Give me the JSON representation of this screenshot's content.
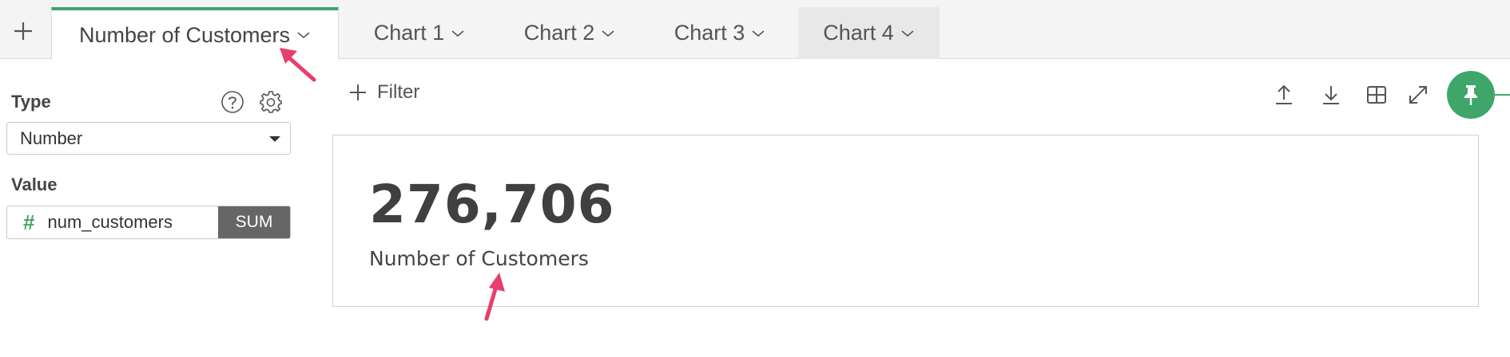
{
  "tabs": [
    {
      "label": "Number of Customers",
      "active": true
    },
    {
      "label": "Chart 1",
      "active": false
    },
    {
      "label": "Chart 2",
      "active": false
    },
    {
      "label": "Chart 3",
      "active": false
    },
    {
      "label": "Chart 4",
      "active": false
    }
  ],
  "sidebar": {
    "type_label": "Type",
    "type_value": "Number",
    "value_label": "Value",
    "value_column": "num_customers",
    "value_symbol": "#",
    "value_aggregation": "SUM"
  },
  "toolbar": {
    "filter_label": "Filter"
  },
  "card": {
    "number": "276,706",
    "label": "Number of Customers"
  },
  "colors": {
    "accent": "#3ea66a",
    "annotation": "#e83e6c"
  }
}
